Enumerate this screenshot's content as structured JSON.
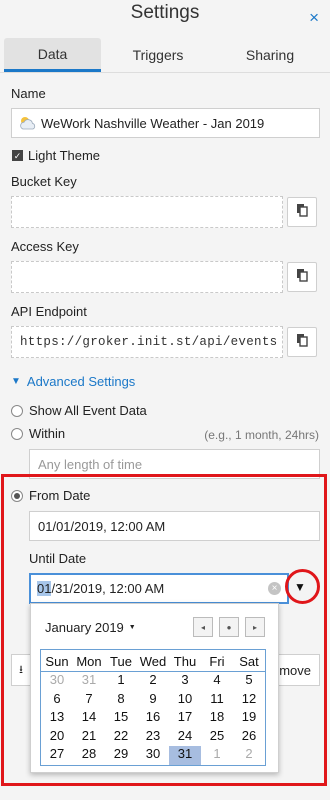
{
  "header": {
    "title": "Settings",
    "close_icon": "×"
  },
  "tabs": [
    {
      "label": "Data"
    },
    {
      "label": "Triggers"
    },
    {
      "label": "Sharing"
    }
  ],
  "name_field": {
    "label": "Name",
    "value": "WeWork Nashville Weather - Jan 2019",
    "icon": "weather-partly-cloudy-icon"
  },
  "light_theme": {
    "label": "Light Theme",
    "checked": true
  },
  "bucket_key": {
    "label": "Bucket Key",
    "value": ""
  },
  "access_key": {
    "label": "Access Key",
    "value": ""
  },
  "api_endpoint": {
    "label": "API Endpoint",
    "value": "https://groker.init.st/api/events"
  },
  "advanced": {
    "label": "Advanced Settings"
  },
  "show_all": {
    "label": "Show All Event Data"
  },
  "within": {
    "label": "Within",
    "hint": "(e.g., 1 month, 24hrs)",
    "placeholder": "Any length of time"
  },
  "from_date": {
    "label": "From Date",
    "value": "01/01/2019, 12:00 AM"
  },
  "until_date": {
    "label": "Until Date",
    "value_highlight": "01",
    "value_rest": "/31/2019, 12:00 AM"
  },
  "behind": {
    "remove_label": "move"
  },
  "calendar": {
    "month_label": "January 2019",
    "day_headers": [
      "Sun",
      "Mon",
      "Tue",
      "Wed",
      "Thu",
      "Fri",
      "Sat"
    ],
    "weeks": [
      [
        "30",
        "31",
        "1",
        "2",
        "3",
        "4",
        "5"
      ],
      [
        "6",
        "7",
        "8",
        "9",
        "10",
        "11",
        "12"
      ],
      [
        "13",
        "14",
        "15",
        "16",
        "17",
        "18",
        "19"
      ],
      [
        "20",
        "21",
        "22",
        "23",
        "24",
        "25",
        "26"
      ],
      [
        "27",
        "28",
        "29",
        "30",
        "31",
        "1",
        "2"
      ]
    ]
  },
  "colors": {
    "accent": "#1b78c8",
    "highlight_red": "#e0161a",
    "selected_day": "#a7bde0"
  }
}
